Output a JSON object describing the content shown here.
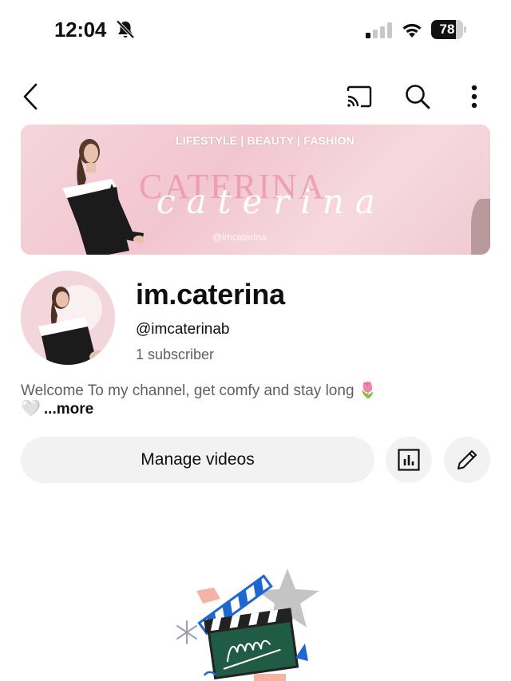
{
  "status_bar": {
    "time": "12:04",
    "battery_level": "78",
    "battery_fraction": 0.78,
    "signal_bars_active": 1,
    "icons": [
      "bell-muted-icon",
      "signal-icon",
      "wifi-icon",
      "battery-icon"
    ]
  },
  "app_bar": {
    "icons": [
      "back-icon",
      "cast-icon",
      "search-icon",
      "more-vert-icon"
    ]
  },
  "banner": {
    "tags": "LIFESTYLE  |  BEAUTY  |  FASHION",
    "title": "CATERINA",
    "script": "caterina",
    "handle": "@imcaterina"
  },
  "channel": {
    "name": "im.caterina",
    "handle": "@imcaterinab",
    "subscribers": "1 subscriber",
    "description": "Welcome To my channel, get comfy and stay long 🌷",
    "more_label": "...more"
  },
  "actions": {
    "manage_videos": "Manage videos",
    "icons": [
      "analytics-icon",
      "edit-pencil-icon"
    ]
  },
  "colors": {
    "surface": "#f2f2f2",
    "text_secondary": "#606060",
    "banner_pink": "#f2c6d1"
  }
}
